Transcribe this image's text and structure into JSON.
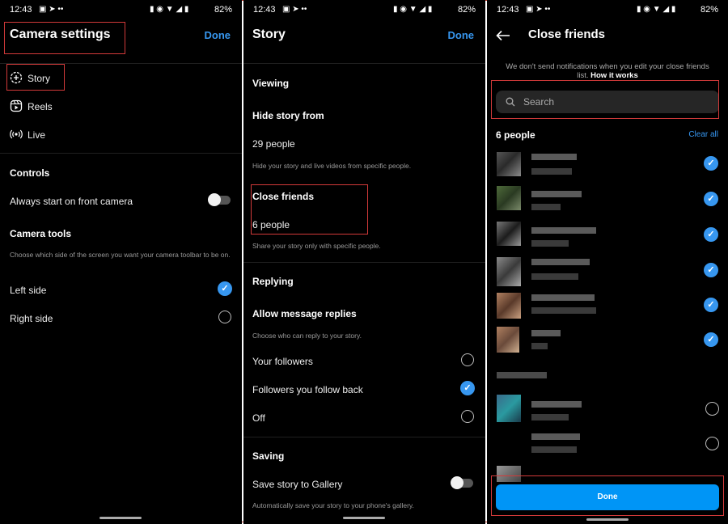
{
  "status": {
    "time": "12:43",
    "battery": "82%"
  },
  "panel1": {
    "title": "Camera settings",
    "done": "Done",
    "menu": [
      {
        "label": "Story",
        "icon": "story-plus-icon"
      },
      {
        "label": "Reels",
        "icon": "reels-icon"
      },
      {
        "label": "Live",
        "icon": "live-icon"
      }
    ],
    "controls_header": "Controls",
    "front_camera": "Always start on front camera",
    "tools_header": "Camera tools",
    "tools_desc": "Choose which side of the screen you want your camera toolbar to be on.",
    "left_side": "Left side",
    "right_side": "Right side"
  },
  "panel2": {
    "title": "Story",
    "done": "Done",
    "viewing": "Viewing",
    "hide_from": "Hide story from",
    "hide_count": "29 people",
    "hide_desc": "Hide your story and live videos from specific people.",
    "close_friends": "Close friends",
    "close_count": "6 people",
    "close_desc": "Share your story only with specific people.",
    "replying": "Replying",
    "allow_replies": "Allow message replies",
    "replies_desc": "Choose who can reply to your story.",
    "opt_followers": "Your followers",
    "opt_follow_back": "Followers you follow back",
    "opt_off": "Off",
    "saving": "Saving",
    "save_gallery": "Save story to Gallery",
    "save_desc": "Automatically save your story to your phone's gallery."
  },
  "panel3": {
    "title": "Close friends",
    "notice": "We don't send notifications when you edit your close friends list.",
    "how_link": "How it works",
    "search_placeholder": "Search",
    "count": "6 people",
    "clear_all": "Clear all",
    "done": "Done"
  },
  "colors": {
    "accent": "#3797f0",
    "button": "#0095f6",
    "highlight_box": "#d23a3a"
  }
}
